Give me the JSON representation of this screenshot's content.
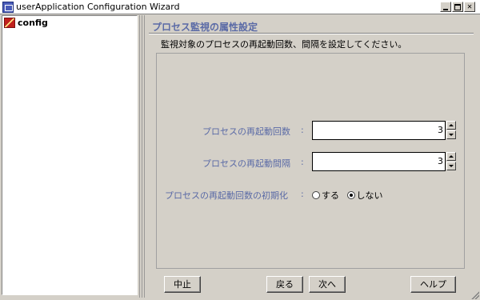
{
  "window": {
    "title": "userApplication Configuration Wizard",
    "icon": "window-app-icon"
  },
  "tree": {
    "items": [
      {
        "label": "config",
        "icon": "config-tree-icon"
      }
    ]
  },
  "page": {
    "title": "プロセス監視の属性設定",
    "description": "監視対象のプロセスの再起動回数、間隔を設定してください。"
  },
  "form": {
    "restart_count": {
      "label": "プロセスの再起動回数",
      "colon": ":",
      "value": "3"
    },
    "restart_interval": {
      "label": "プロセスの再起動間隔",
      "colon": ":",
      "value": "3"
    },
    "reset_restart_count": {
      "label": "プロセスの再起動回数の初期化",
      "colon": ":",
      "options": [
        {
          "label": "する",
          "selected": false
        },
        {
          "label": "しない",
          "selected": true
        }
      ]
    }
  },
  "buttons": {
    "cancel": "中止",
    "back": "戻る",
    "next": "次へ",
    "help": "ヘルプ"
  },
  "colors": {
    "label_accent": "#5a6aa6",
    "background": "#d4d0c8"
  }
}
